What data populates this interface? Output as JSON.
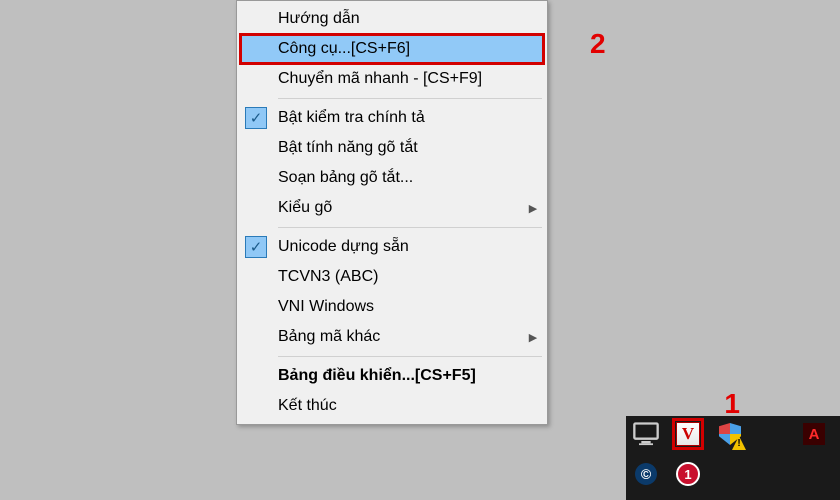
{
  "menu": {
    "items": [
      {
        "label": "Hướng dẫn"
      },
      {
        "label": "Công cụ...[CS+F6]"
      },
      {
        "label": "Chuyển mã nhanh - [CS+F9]"
      },
      {
        "label": "Bật kiểm tra chính tả"
      },
      {
        "label": "Bật tính năng gõ tắt"
      },
      {
        "label": "Soạn bảng gõ tắt..."
      },
      {
        "label": "Kiểu gõ"
      },
      {
        "label": "Unicode dựng sẵn"
      },
      {
        "label": "TCVN3 (ABC)"
      },
      {
        "label": "VNI Windows"
      },
      {
        "label": "Bảng mã khác"
      },
      {
        "label": "Bảng điều khiển...[CS+F5]"
      },
      {
        "label": "Kết thúc"
      }
    ]
  },
  "callouts": {
    "one": "1",
    "two": "2"
  },
  "tray": {
    "v_letter": "V",
    "adobe_letter": "A",
    "copyright": "©",
    "notif": "1"
  }
}
